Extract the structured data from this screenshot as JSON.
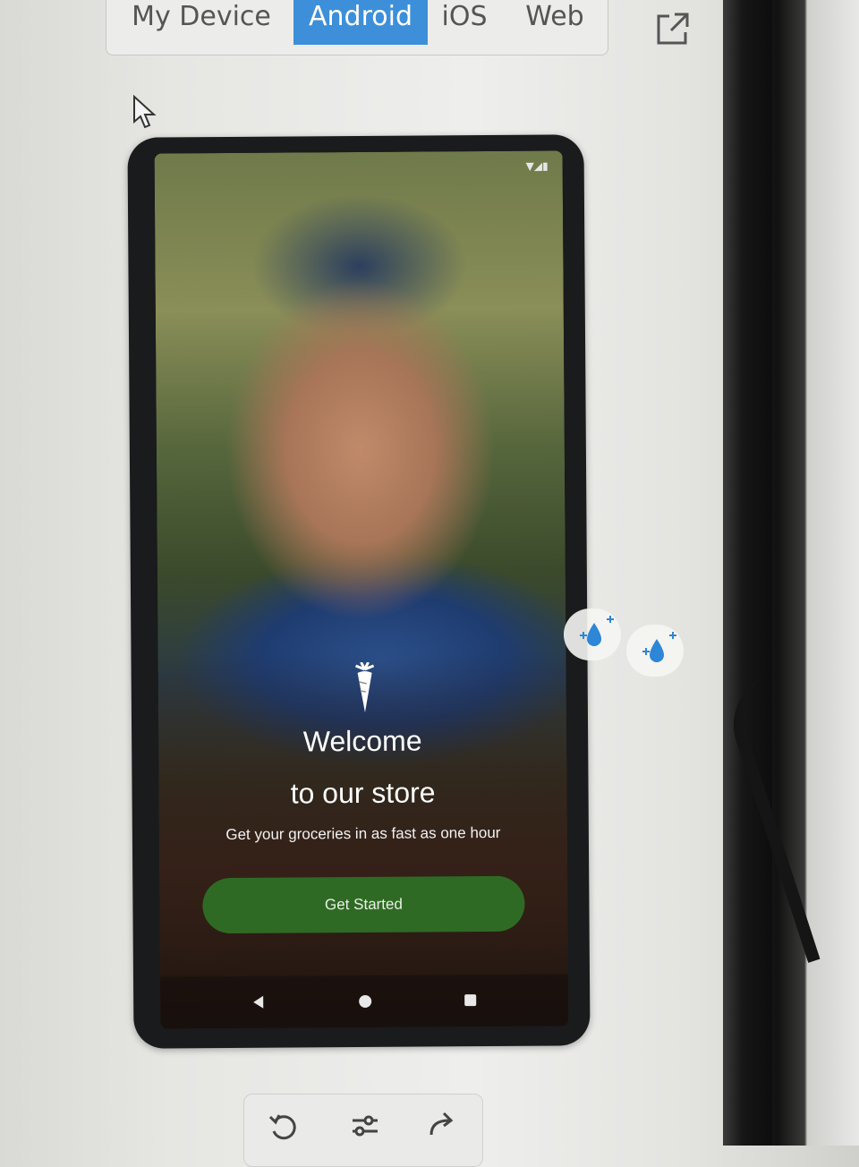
{
  "preview_tabs": {
    "items": [
      {
        "label": "My Device",
        "active": false
      },
      {
        "label": "Android",
        "active": true
      },
      {
        "label": "iOS",
        "active": false
      },
      {
        "label": "Web",
        "active": false
      }
    ],
    "accent_color": "#3d8fd9"
  },
  "icons": {
    "open_external": "open-external-icon",
    "cursor": "mouse-pointer-icon",
    "carrot": "carrot-logo-icon",
    "droplet": "water-droplet-sparkle-icon",
    "undo": "rotate-left-icon",
    "settings": "sliders-icon",
    "redo": "redo-arrow-icon"
  },
  "app_screen": {
    "title_line1": "Welcome",
    "title_line2": "to our store",
    "subtitle": "Get your groceries in as fast as one hour",
    "cta_label": "Get Started",
    "cta_color": "#2f6a24"
  }
}
